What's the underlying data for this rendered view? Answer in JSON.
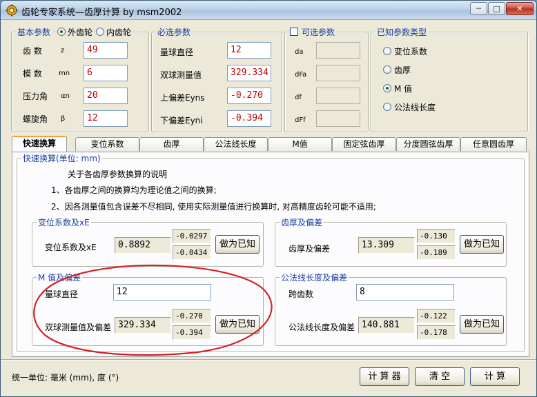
{
  "window": {
    "title": "齿轮专家系统—齿厚计算 by msm2002",
    "minimize": "─",
    "maximize": "□",
    "close": "✕"
  },
  "basic": {
    "legend": "基本参数",
    "external_gear": "外齿轮",
    "internal_gear": "内齿轮",
    "selected": "external",
    "rows": [
      {
        "label": "齿  数",
        "sub": "z",
        "value": "49"
      },
      {
        "label": "模  数",
        "sub": "mn",
        "value": "6"
      },
      {
        "label": "压力角",
        "sub": "αn",
        "value": "20"
      },
      {
        "label": "螺旋角",
        "sub": "β",
        "value": "12"
      }
    ]
  },
  "required": {
    "legend": "必选参数",
    "rows": [
      {
        "label": "量球直径",
        "value": "12"
      },
      {
        "label": "双球测量值",
        "value": "329.334"
      },
      {
        "label": "上偏差Eyns",
        "value": "-0.270"
      },
      {
        "label": "下偏差Eyni",
        "value": "-0.394"
      }
    ]
  },
  "optional": {
    "legend": "可选参数",
    "checked": false,
    "rows": [
      {
        "label": "da",
        "value": ""
      },
      {
        "label": "dFa",
        "value": ""
      },
      {
        "label": "df",
        "value": ""
      },
      {
        "label": "dFf",
        "value": ""
      }
    ]
  },
  "known_type": {
    "legend": "已知参数类型",
    "options": [
      "变位系数",
      "齿厚",
      "M 值",
      "公法线长度"
    ],
    "selected_index": 2
  },
  "tabs": [
    "快速换算",
    "变位系数",
    "齿厚",
    "公法线长度",
    "M值",
    "固定弦齿厚",
    "分度圆弦齿厚",
    "任意圆齿厚"
  ],
  "active_tab": 0,
  "quick": {
    "legend": "快速换算(单位: mm)",
    "note_title": "关于各齿厚参数换算的说明",
    "note_1": "1、各齿厚之间的换算均为理论值之间的换算;",
    "note_2": "2、因各测量值包含误差不尽相同, 使用实际测量值进行换算时, 对高精度齿轮可能不适用;",
    "shift": {
      "legend": "变位系数及xE",
      "label": "变位系数及xE",
      "value": "0.8892",
      "upper": "-0.0297",
      "lower": "-0.0434",
      "button": "做为已知"
    },
    "thickness": {
      "legend": "齿厚及偏差",
      "label": "齿厚及偏差",
      "value": "13.309",
      "upper": "-0.130",
      "lower": "-0.189",
      "button": "做为已知"
    },
    "mvalue": {
      "legend": "M 值及偏差",
      "ball_label": "量球直径",
      "ball_value": "12",
      "label": "双球测量值及偏差",
      "value": "329.334",
      "upper": "-0.270",
      "lower": "-0.394",
      "button": "做为已知"
    },
    "span": {
      "legend": "公法线长度及偏差",
      "teeth_label": "跨齿数",
      "teeth_value": "8",
      "label": "公法线长度及偏差",
      "value": "140.881",
      "upper": "-0.122",
      "lower": "-0.178",
      "button": "做为已知"
    }
  },
  "footer": {
    "units": "统一单位: 毫米 (mm), 度 (°)",
    "calculator": "计 算 器",
    "clear": "清  空",
    "compute": "计  算"
  },
  "colors": {
    "legend_text": "#1a3fa0",
    "input_value": "#c00000",
    "annotation": "#d42020",
    "active_tab_accent": "#f1a23a"
  }
}
